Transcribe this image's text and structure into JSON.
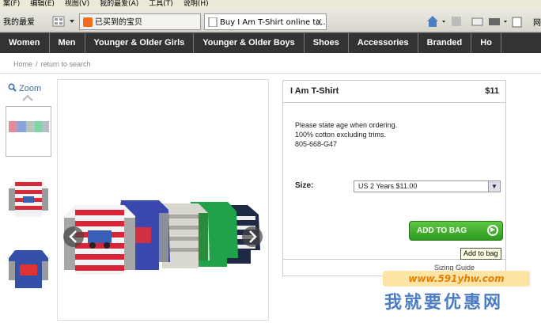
{
  "menubar": {
    "items": [
      "案(F)",
      "编辑(E)",
      "视图(V)",
      "我的最爱(A)",
      "工具(T)",
      "说明(H)"
    ]
  },
  "browser": {
    "favorites_label": "我的最爱",
    "tabs": [
      {
        "title": "已买到的宝贝"
      },
      {
        "title": "Buy I Am T-Shirt online to..."
      }
    ],
    "tab_close": "X",
    "right_label": "网"
  },
  "site_nav": {
    "items": [
      "Women",
      "Men",
      "Younger & Older Girls",
      "Younger & Older Boys",
      "Shoes",
      "Accessories",
      "Branded",
      "Ho"
    ]
  },
  "breadcrumb": {
    "home": "Home",
    "separator": "/",
    "back": "return to search"
  },
  "gallery": {
    "zoom_label": "Zoom"
  },
  "product": {
    "title": "I Am T-Shirt",
    "price": "$11",
    "desc_line1": "Please state age when ordering.",
    "desc_line2": "100% cotton excluding trims.",
    "desc_line3": "805-668-G47",
    "size_label": "Size:",
    "size_value": "US 2 Years $11.00",
    "add_button": "ADD TO BAG",
    "tooltip": "Add to bag",
    "sizing_guide": "Sizing Guide"
  },
  "watermark": {
    "url": "www.591yhw.com",
    "text": "我就要优惠网"
  },
  "colors": {
    "nav_bg": "#333333",
    "add_button": "#3fae2a",
    "link": "#3a6ea5"
  }
}
